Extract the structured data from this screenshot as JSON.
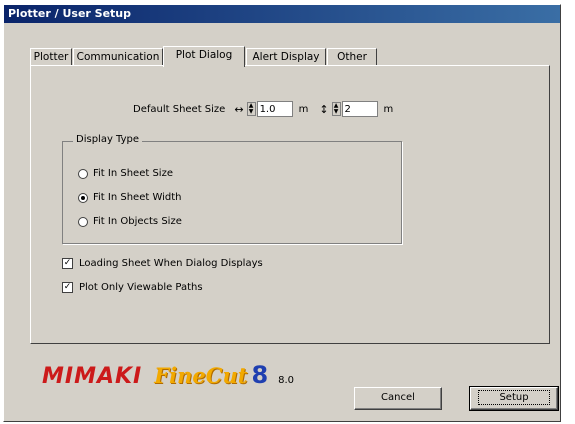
{
  "window": {
    "title": "Plotter / User Setup"
  },
  "tabs": [
    {
      "label": "Plotter"
    },
    {
      "label": "Communication"
    },
    {
      "label": "Plot Dialog"
    },
    {
      "label": "Alert Display"
    },
    {
      "label": "Other"
    }
  ],
  "sheet_size": {
    "label": "Default Sheet Size",
    "width_icon": "↔",
    "width_value": "1.0",
    "width_unit": "m",
    "height_icon": "↕",
    "height_value": "2",
    "height_unit": "m"
  },
  "display_type": {
    "title": "Display Type",
    "options": [
      {
        "label": "Fit In Sheet Size",
        "selected": false
      },
      {
        "label": "Fit In Sheet Width",
        "selected": true
      },
      {
        "label": "Fit In Objects Size",
        "selected": false
      }
    ]
  },
  "checkboxes": [
    {
      "label": "Loading Sheet When Dialog Displays",
      "checked": true
    },
    {
      "label": "Plot Only Viewable Paths",
      "checked": true
    }
  ],
  "branding": {
    "mimaki": "MIMAKI",
    "finecut": "FineCut",
    "eight": "8",
    "version": "8.0"
  },
  "buttons": {
    "cancel": "Cancel",
    "setup": "Setup"
  }
}
